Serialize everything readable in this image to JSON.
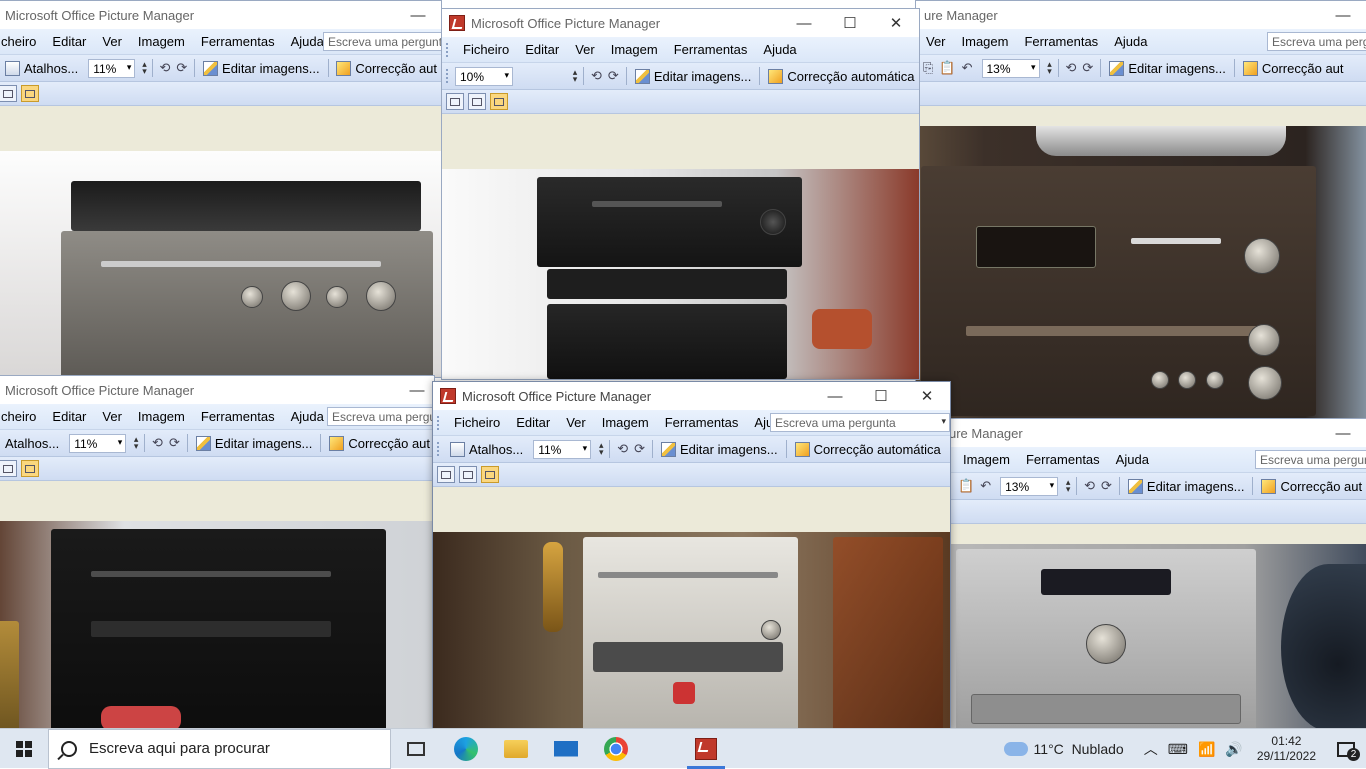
{
  "app": {
    "title": "Microsoft Office Picture Manager",
    "title_partial": "ure Manager",
    "menus": [
      "Ficheiro",
      "Editar",
      "Ver",
      "Imagem",
      "Ferramentas",
      "Ajuda"
    ],
    "menus_partial_left": [
      "cheiro",
      "Editar",
      "Ver",
      "Imagem",
      "Ferramentas",
      "Ajuda"
    ],
    "ask_placeholder": "Escreva uma pergunta",
    "ask_placeholder_partial": "Escreva uma pergunt",
    "shortcuts_label": "Atalhos...",
    "edit_images_label": "Editar imagens...",
    "auto_correct_label": "Correcção automática",
    "auto_correct_partial": "Correcção aut",
    "caption_min": "—",
    "caption_max": "☐",
    "caption_close": "✕"
  },
  "windows": {
    "top_left": {
      "zoom": "11%"
    },
    "top_center": {
      "zoom": "10%"
    },
    "top_right": {
      "zoom": "13%"
    },
    "bottom_left": {
      "zoom": "11%"
    },
    "bottom_center": {
      "zoom": "11%"
    },
    "bottom_right": {
      "zoom": "13%"
    }
  },
  "taskbar": {
    "search_placeholder": "Escreva aqui para procurar",
    "weather": "11°C  Nublado",
    "time": "01:42",
    "date": "29/11/2022",
    "notification_count": "2",
    "apps": [
      "task-view",
      "edge",
      "file-explorer",
      "mail",
      "chrome",
      "picture-manager"
    ]
  },
  "colors": {
    "menubar": "#dbe7f8",
    "beige": "#ecead9",
    "taskbar": "#dfe7f1",
    "active_view": "#fbd77e"
  }
}
